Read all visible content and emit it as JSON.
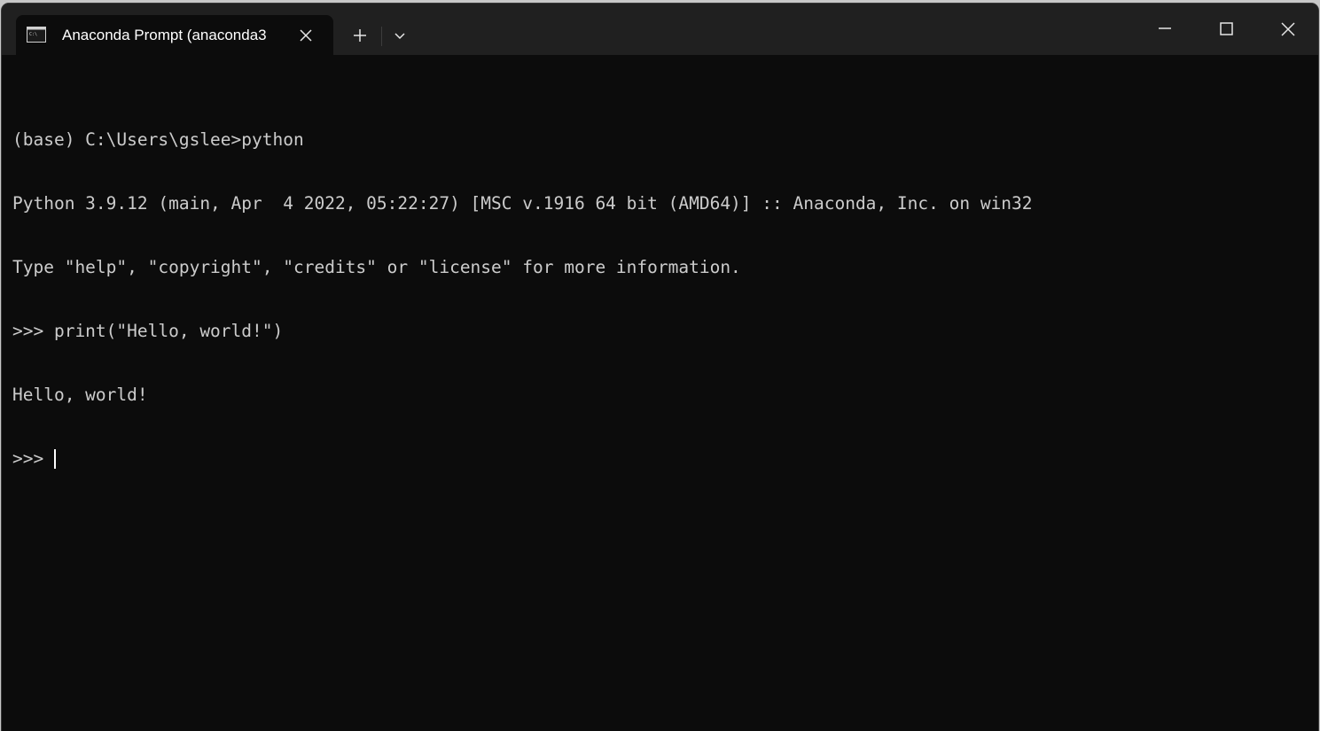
{
  "window": {
    "tab_title": "Anaconda Prompt (anaconda3",
    "tab_icon": "console-icon",
    "buttons": {
      "close_tab": "close-icon",
      "new_tab": "plus-icon",
      "dropdown": "chevron-down-icon",
      "minimize": "minimize-icon",
      "maximize": "maximize-icon",
      "close_window": "close-icon"
    }
  },
  "terminal": {
    "lines": [
      "(base) C:\\Users\\gslee>python",
      "Python 3.9.12 (main, Apr  4 2022, 05:22:27) [MSC v.1916 64 bit (AMD64)] :: Anaconda, Inc. on win32",
      "Type \"help\", \"copyright\", \"credits\" or \"license\" for more information.",
      ">>> print(\"Hello, world!\")",
      "Hello, world!"
    ],
    "prompt": ">>> "
  },
  "colors": {
    "background": "#0c0c0c",
    "titlebar": "#202020",
    "text": "#cccccc"
  }
}
